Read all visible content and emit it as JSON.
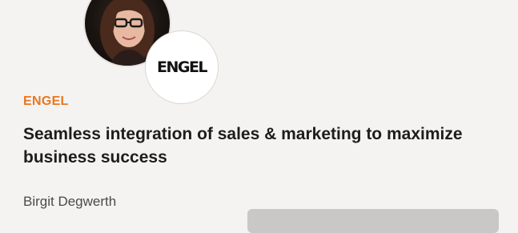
{
  "session": {
    "company": "ENGEL",
    "logo_text": "ENGEL",
    "title": "Seamless integration of sales & marketing to maximize business success",
    "speaker": "Birgit Degwerth"
  },
  "colors": {
    "accent": "#e87722",
    "background": "#f4f3f1",
    "button": "#c9c8c6"
  }
}
